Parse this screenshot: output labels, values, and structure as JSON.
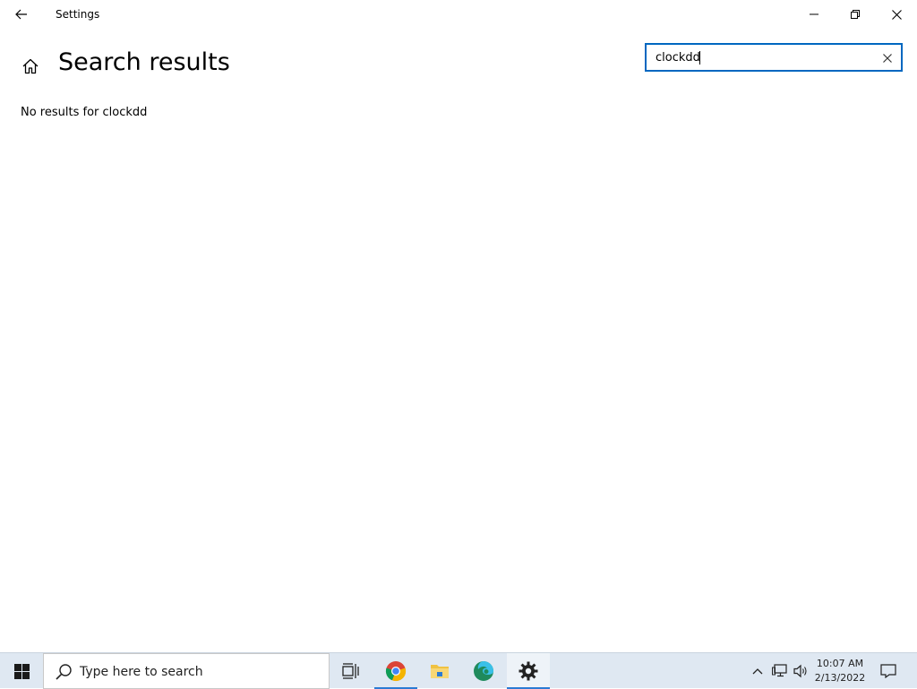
{
  "titlebar": {
    "app_title": "Settings",
    "back_icon": "arrow-left-icon",
    "minimize_icon": "minimize-icon",
    "maximize_icon": "restore-icon",
    "close_icon": "close-icon"
  },
  "header": {
    "home_icon": "home-icon",
    "title": "Search results"
  },
  "search": {
    "value": "clockdd",
    "clear_icon": "close-icon"
  },
  "results": {
    "message": "No results for clockdd"
  },
  "taskbar": {
    "search_placeholder": "Type here to search",
    "apps": [
      {
        "name": "task-view",
        "icon": "task-view-icon"
      },
      {
        "name": "chrome",
        "icon": "chrome-icon"
      },
      {
        "name": "file-explorer",
        "icon": "folder-icon"
      },
      {
        "name": "edge",
        "icon": "edge-icon"
      },
      {
        "name": "settings",
        "icon": "gear-icon"
      }
    ],
    "tray": {
      "time": "10:07 AM",
      "date": "2/13/2022"
    }
  },
  "colors": {
    "accent": "#0067c0",
    "taskbar_bg": "#dfe8f2",
    "underline": "#2b7bd4"
  }
}
